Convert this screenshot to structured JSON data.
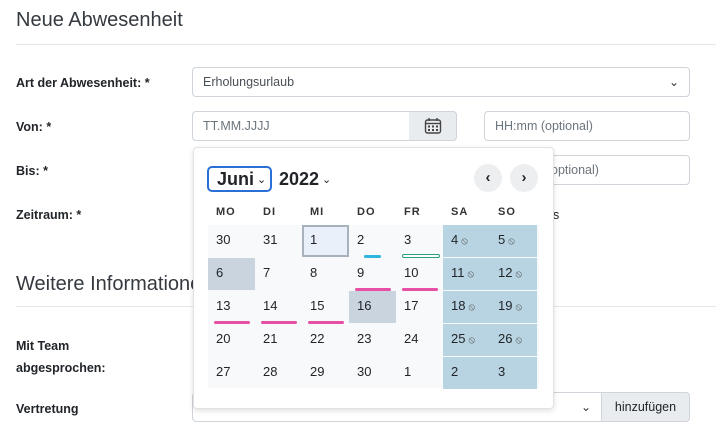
{
  "header": {
    "title": "Neue Abwesenheit",
    "section2": "Weitere Informationen"
  },
  "form": {
    "art_label": "Art der Abwesenheit: *",
    "art_value": "Erholungsurlaub",
    "von_label": "Von: *",
    "von_placeholder": "TT.MM.JJJJ",
    "von_time_placeholder": "HH:mm (optional)",
    "bis_label": "Bis: *",
    "bis_time_placeholder": "optional)",
    "zeitraum_label": "Zeitraum: *",
    "zeitraum_tail": "s",
    "team_label_1": "Mit Team",
    "team_label_2": "abgesprochen:",
    "vertretung_label": "Vertretung",
    "add_button": "hinzufügen"
  },
  "calendar": {
    "month": "Juni",
    "year": "2022",
    "weekdays": [
      "MO",
      "DI",
      "MI",
      "DO",
      "FR",
      "SA",
      "SO"
    ],
    "weeks": [
      [
        "30",
        "31",
        "1",
        "2",
        "3",
        "4",
        "5"
      ],
      [
        "6",
        "7",
        "8",
        "9",
        "10",
        "11",
        "12"
      ],
      [
        "13",
        "14",
        "15",
        "16",
        "17",
        "18",
        "19"
      ],
      [
        "20",
        "21",
        "22",
        "23",
        "24",
        "25",
        "26"
      ],
      [
        "27",
        "28",
        "29",
        "30",
        "1",
        "2",
        "3"
      ]
    ],
    "colors": {
      "weekend": "#b8d4e2",
      "holiday": "#c9d4df",
      "pink_bar": "#e64fa3",
      "cyan_bar": "#2db5e0",
      "green_bar": "#28a07a"
    }
  }
}
